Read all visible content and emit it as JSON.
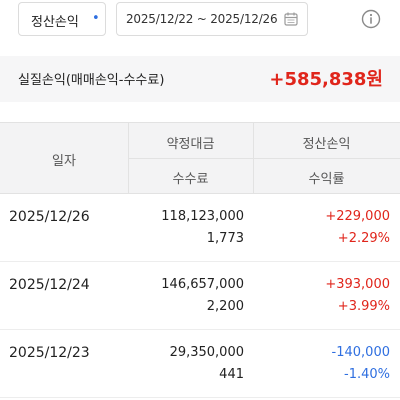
{
  "filter": {
    "type_label": "정산손익",
    "date_range": "2025/12/22 ~ 2025/12/26"
  },
  "summary": {
    "label": "실질손익(매매손익-수수료)",
    "value": "+585,838원"
  },
  "table": {
    "headers": {
      "date": "일자",
      "amount": "약정대금",
      "fee": "수수료",
      "pl": "정산손익",
      "rate": "수익률"
    },
    "rows": [
      {
        "date": "2025/12/26",
        "amount": "118,123,000",
        "fee": "1,773",
        "pl": "+229,000",
        "rate": "+2.29%"
      },
      {
        "date": "2025/12/24",
        "amount": "146,657,000",
        "fee": "2,200",
        "pl": "+393,000",
        "rate": "+3.99%"
      },
      {
        "date": "2025/12/23",
        "amount": "29,350,000",
        "fee": "441",
        "pl": "-140,000",
        "rate": "-1.40%"
      }
    ]
  },
  "colors": {
    "positive": "#e0251b",
    "negative": "#2f6fe0",
    "accent": "#2f6fe0"
  },
  "icons": [
    "calendar-icon",
    "info-icon",
    "dropdown-dot-icon"
  ]
}
